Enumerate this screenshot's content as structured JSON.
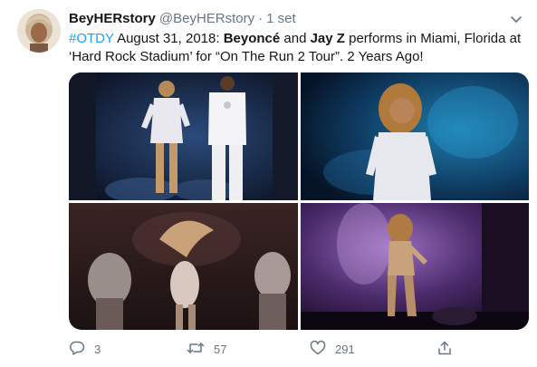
{
  "tweet": {
    "display_name": "BeyHERstory",
    "handle": "@BeyHERstory",
    "separator": "·",
    "time": "1 set",
    "text": {
      "hashtag": "#OTDY",
      "part1": " August 31, 2018: ",
      "name1": "Beyoncé",
      "part2": " and ",
      "name2": "Jay Z",
      "part3": " performs in Miami, Florida at ‘Hard Rock Stadium’ for “On The Run 2 Tour”. 2 Years Ago!"
    },
    "icons": {
      "menu": "chevron-down-icon",
      "reply": "reply-icon",
      "retweet": "retweet-icon",
      "like": "heart-icon",
      "share": "share-icon"
    },
    "counts": {
      "replies": "3",
      "retweets": "57",
      "likes": "291"
    }
  },
  "colors": {
    "accent": "#1da1f2",
    "secondary_text": "#657786",
    "primary_text": "#14171a"
  }
}
